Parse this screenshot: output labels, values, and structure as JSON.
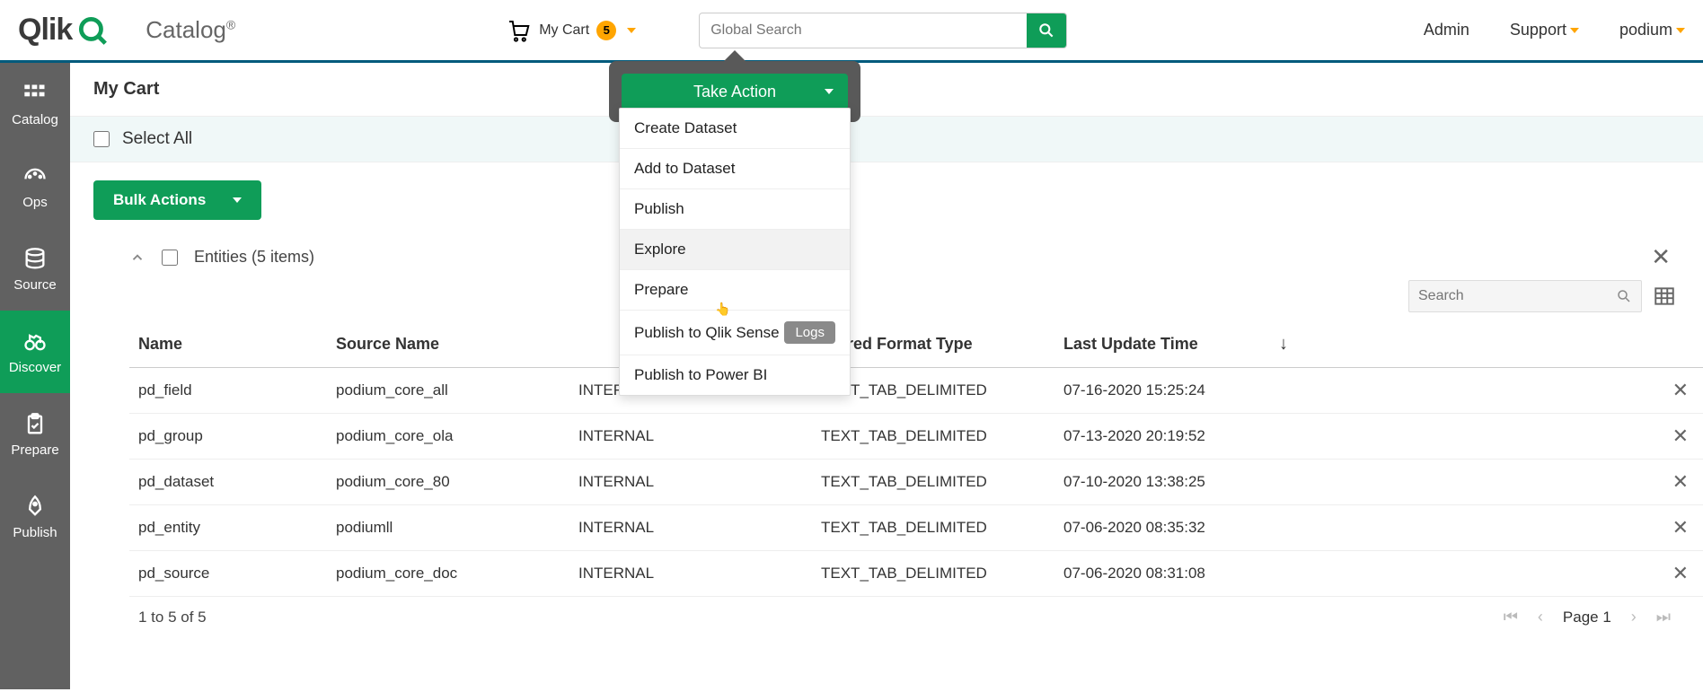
{
  "header": {
    "logo_text": "Qlik",
    "product": "Catalog",
    "cart_label": "My Cart",
    "cart_count": "5",
    "global_search_placeholder": "Global Search",
    "links": {
      "admin": "Admin",
      "support": "Support",
      "user": "podium"
    }
  },
  "sidebar": {
    "items": [
      {
        "label": "Catalog"
      },
      {
        "label": "Ops"
      },
      {
        "label": "Source"
      },
      {
        "label": "Discover"
      },
      {
        "label": "Prepare"
      },
      {
        "label": "Publish"
      }
    ]
  },
  "page": {
    "title": "My Cart",
    "select_all": "Select All",
    "bulk_actions": "Bulk Actions",
    "entities_header": "Entities (5 items)"
  },
  "table": {
    "search_placeholder": "Search",
    "columns": {
      "name": "Name",
      "source_name": "Source Name",
      "source_type": "",
      "stored_format": "Stored Format Type",
      "last_update": "Last Update Time"
    },
    "rows": [
      {
        "name": "pd_field",
        "source_name": "podium_core_all",
        "source_type": "INTERNAL",
        "stored_format": "TEXT_TAB_DELIMITED",
        "last_update": "07-16-2020 15:25:24"
      },
      {
        "name": "pd_group",
        "source_name": "podium_core_ola",
        "source_type": "INTERNAL",
        "stored_format": "TEXT_TAB_DELIMITED",
        "last_update": "07-13-2020 20:19:52"
      },
      {
        "name": "pd_dataset",
        "source_name": "podium_core_80",
        "source_type": "INTERNAL",
        "stored_format": "TEXT_TAB_DELIMITED",
        "last_update": "07-10-2020 13:38:25"
      },
      {
        "name": "pd_entity",
        "source_name": "podiumll",
        "source_type": "INTERNAL",
        "stored_format": "TEXT_TAB_DELIMITED",
        "last_update": "07-06-2020 08:35:32"
      },
      {
        "name": "pd_source",
        "source_name": "podium_core_doc",
        "source_type": "INTERNAL",
        "stored_format": "TEXT_TAB_DELIMITED",
        "last_update": "07-06-2020 08:31:08"
      }
    ],
    "footer": "1 to 5 of 5",
    "page_label": "Page 1"
  },
  "popover": {
    "take_action": "Take Action",
    "items": {
      "create_dataset": "Create Dataset",
      "add_to_dataset": "Add to Dataset",
      "publish": "Publish",
      "explore": "Explore",
      "prepare": "Prepare",
      "publish_qlik": "Publish to Qlik Sense",
      "logs": "Logs",
      "publish_powerbi": "Publish to Power BI"
    }
  },
  "colors": {
    "primary_green": "#0F9D58",
    "sidebar_gray": "#616161"
  }
}
